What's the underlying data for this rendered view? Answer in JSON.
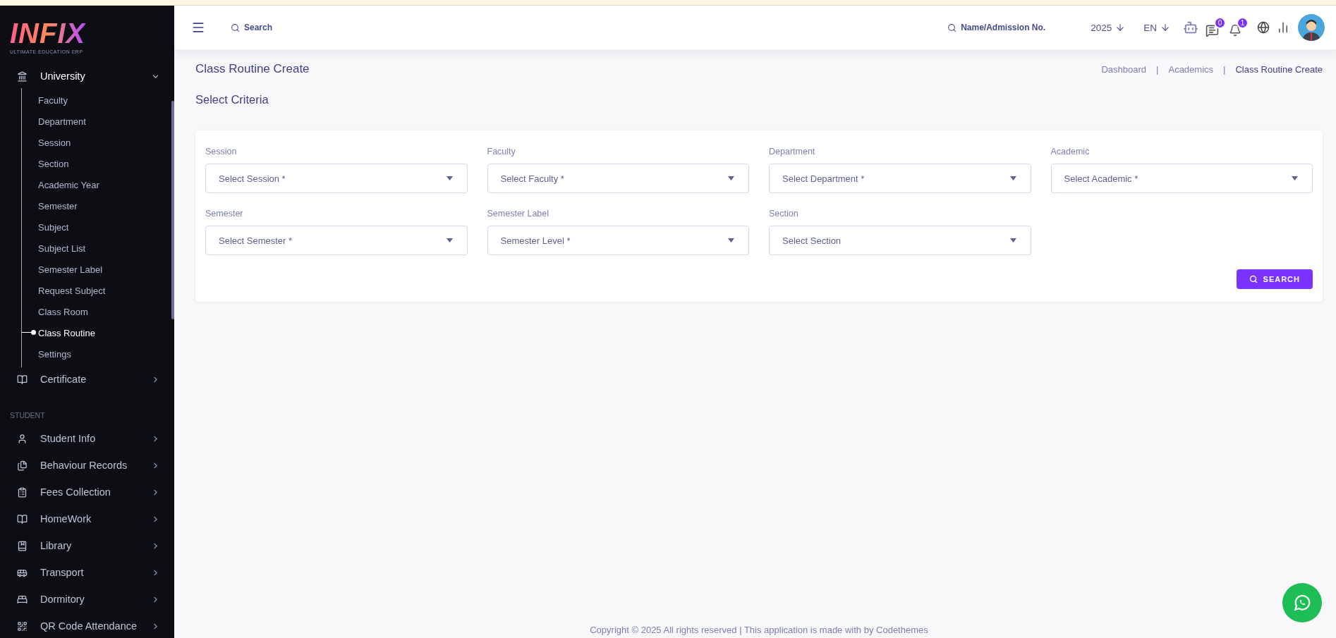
{
  "logo": {
    "title": "INFIX",
    "tagline": "ULTIMATE EDUCATION ERP"
  },
  "sidebar": {
    "groups": [
      {
        "label": "University",
        "expanded": true,
        "children": [
          {
            "label": "Faculty",
            "selected": false
          },
          {
            "label": "Department",
            "selected": false
          },
          {
            "label": "Session",
            "selected": false
          },
          {
            "label": "Section",
            "selected": false
          },
          {
            "label": "Academic Year",
            "selected": false
          },
          {
            "label": "Semester",
            "selected": false
          },
          {
            "label": "Subject",
            "selected": false
          },
          {
            "label": "Subject List",
            "selected": false
          },
          {
            "label": "Semester Label",
            "selected": false
          },
          {
            "label": "Request Subject",
            "selected": false
          },
          {
            "label": "Class Room",
            "selected": false
          },
          {
            "label": "Class Routine",
            "selected": true
          },
          {
            "label": "Settings",
            "selected": false
          }
        ]
      },
      {
        "label": "Certificate",
        "expanded": false
      }
    ],
    "sections": [
      {
        "heading": "STUDENT",
        "items": [
          {
            "label": "Student Info",
            "expanded": false
          },
          {
            "label": "Behaviour Records",
            "expanded": false
          },
          {
            "label": "Fees Collection",
            "expanded": false
          },
          {
            "label": "HomeWork",
            "expanded": false
          },
          {
            "label": "Library",
            "expanded": false
          },
          {
            "label": "Transport",
            "expanded": false
          },
          {
            "label": "Dormitory",
            "expanded": false
          },
          {
            "label": "QR Code Attendance",
            "expanded": false
          }
        ]
      }
    ]
  },
  "header": {
    "search": "Search",
    "student_search": "Name/Admission No.",
    "year": "2025",
    "language": "EN",
    "message_count": "0",
    "notification_count": "1"
  },
  "page": {
    "title": "Class Routine Create",
    "breadcrumbs": [
      {
        "label": "Dashboard",
        "selected": false
      },
      {
        "label": "Academics",
        "selected": false
      },
      {
        "label": "Class Routine Create",
        "selected": true
      }
    ],
    "breadcrumb_separators": [
      "|",
      "|"
    ],
    "subtitle": "Select Criteria"
  },
  "form": {
    "fields": [
      {
        "label": "Session",
        "placeholder": "Select Session *"
      },
      {
        "label": "Faculty",
        "placeholder": "Select Faculty *"
      },
      {
        "label": "Department",
        "placeholder": "Select Department *"
      },
      {
        "label": "Academic",
        "placeholder": "Select Academic *"
      },
      {
        "label": "Semester",
        "placeholder": "Select Semester *"
      },
      {
        "label": "Semester Label",
        "placeholder": "Semester Level *"
      },
      {
        "label": "Section",
        "placeholder": "Select Section"
      }
    ],
    "button": "SEARCH"
  },
  "footer": "Copyright © 2025 All rights reserved | This application is made with by Codethemes"
}
